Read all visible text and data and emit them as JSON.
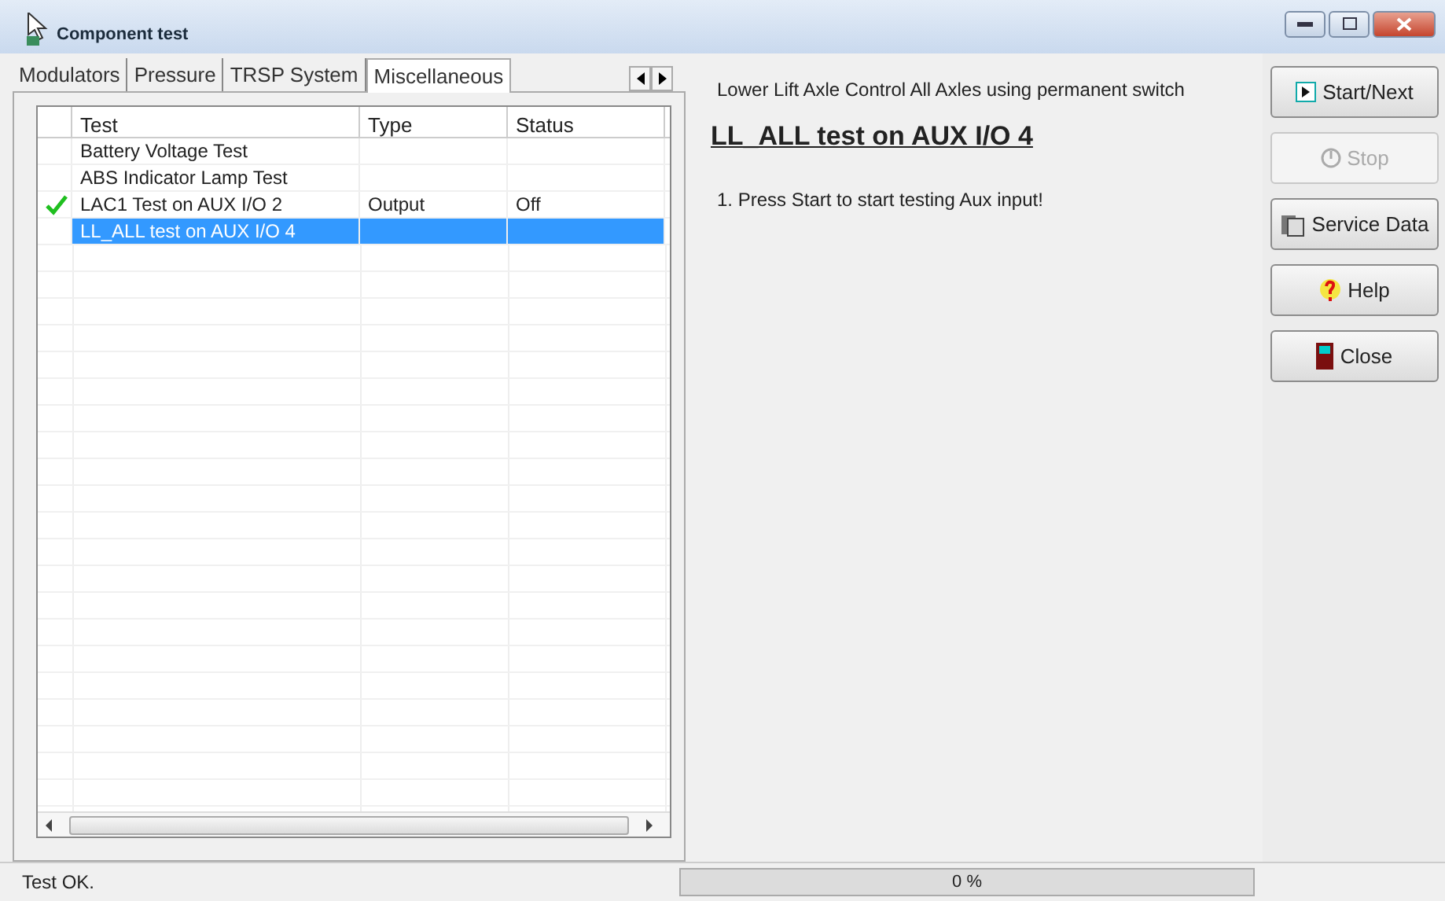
{
  "window": {
    "title": "Component test"
  },
  "tabs": [
    {
      "label": "Modulators",
      "selected": false
    },
    {
      "label": "Pressure",
      "selected": false
    },
    {
      "label": "TRSP System",
      "selected": false
    },
    {
      "label": "Miscellaneous",
      "selected": true
    }
  ],
  "table": {
    "columns": [
      "Test",
      "Type",
      "Status"
    ],
    "rows": [
      {
        "test": "Battery Voltage Test",
        "type": "",
        "status": "",
        "checked": false,
        "selected": false
      },
      {
        "test": "ABS Indicator Lamp Test",
        "type": "",
        "status": "",
        "checked": false,
        "selected": false
      },
      {
        "test": "LAC1 Test on AUX I/O 2",
        "type": "Output",
        "status": "Off",
        "checked": true,
        "selected": false
      },
      {
        "test": "LL_ALL test on AUX I/O 4",
        "type": "",
        "status": "",
        "checked": false,
        "selected": true
      }
    ]
  },
  "detail": {
    "description": "Lower Lift Axle Control  All  Axles using permanent switch",
    "heading": "LL_ALL test on AUX I/O 4",
    "instruction": "1. Press Start to start testing Aux input!"
  },
  "buttons": [
    {
      "label": "Start/Next",
      "kind": "play",
      "disabled": false
    },
    {
      "label": "Stop",
      "kind": "stop",
      "disabled": true
    },
    {
      "label": "Service Data",
      "kind": "data",
      "disabled": false
    },
    {
      "label": "Help",
      "kind": "help",
      "disabled": false
    },
    {
      "label": "Close",
      "kind": "door",
      "disabled": false
    }
  ],
  "status_bar": {
    "message": "Test OK.",
    "progress": {
      "level": 0,
      "reading": "0 %"
    }
  }
}
